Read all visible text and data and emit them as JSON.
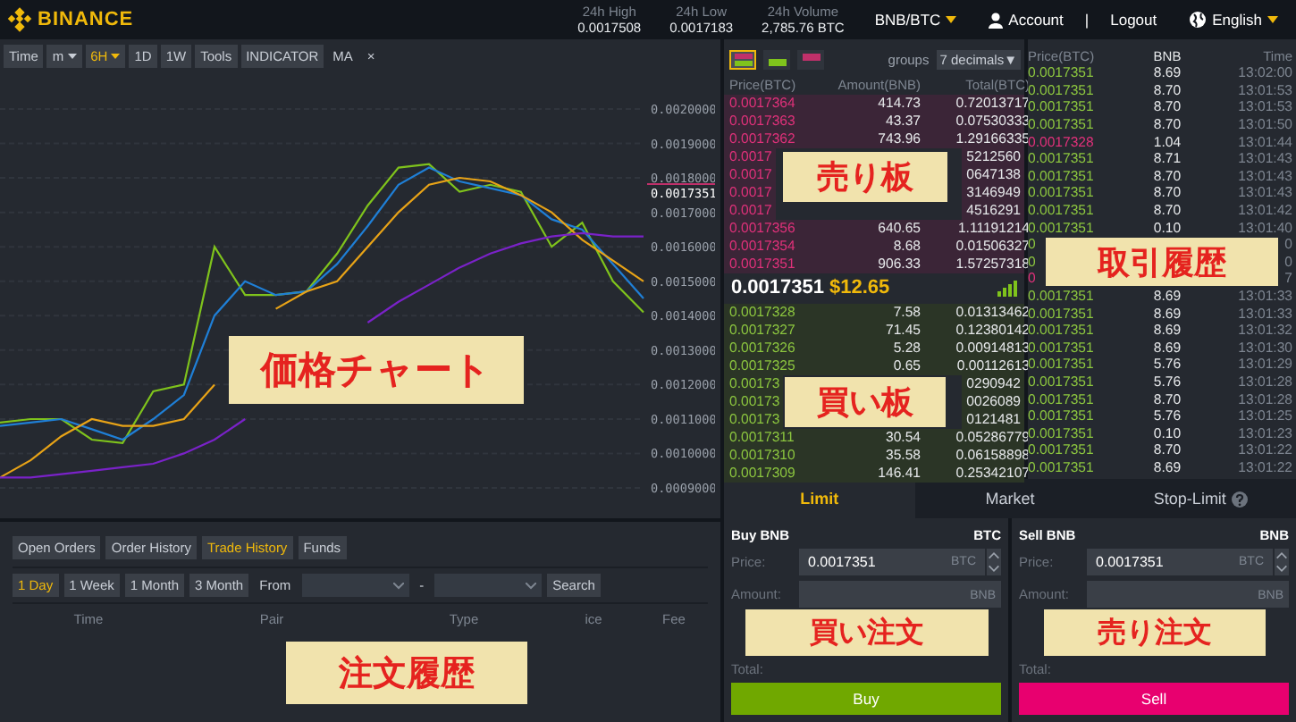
{
  "header": {
    "logo": "BINANCE",
    "stats": [
      {
        "label": "24h High",
        "value": "0.0017508"
      },
      {
        "label": "24h Low",
        "value": "0.0017183"
      },
      {
        "label": "24h Volume",
        "value": "2,785.76 BTC"
      }
    ],
    "pair": "BNB/BTC",
    "account": "Account",
    "separator": "|",
    "logout": "Logout",
    "language": "English"
  },
  "chart": {
    "toolbar": [
      {
        "label": "Time",
        "dropdown": false,
        "selected": false
      },
      {
        "label": "m",
        "dropdown": true,
        "selected": false
      },
      {
        "label": "6H",
        "dropdown": true,
        "selected": true
      },
      {
        "label": "1D",
        "dropdown": false,
        "selected": false
      },
      {
        "label": "1W",
        "dropdown": false,
        "selected": false
      },
      {
        "label": "Tools",
        "dropdown": false,
        "selected": false
      },
      {
        "label": "INDICATOR",
        "dropdown": false,
        "selected": false
      }
    ],
    "indicator": "MA",
    "close": "×",
    "current_price": "0.0017351",
    "annotation": "価格チャート",
    "chart_data": {
      "type": "line",
      "grid": true,
      "ylim": [
        0.0009,
        0.002
      ],
      "yticks": [
        {
          "value": 0.0009,
          "label": "0.0009000"
        },
        {
          "value": 0.001,
          "label": "0.0010000"
        },
        {
          "value": 0.0011,
          "label": "0.0011000"
        },
        {
          "value": 0.0012,
          "label": "0.0012000"
        },
        {
          "value": 0.0013,
          "label": "0.0013000"
        },
        {
          "value": 0.0014,
          "label": "0.0014000"
        },
        {
          "value": 0.0015,
          "label": "0.0015000"
        },
        {
          "value": 0.0016,
          "label": "0.0016000"
        },
        {
          "value": 0.0017,
          "label": "0.0017000"
        },
        {
          "value": 0.0018,
          "label": "0.0018000"
        },
        {
          "value": 0.0019,
          "label": "0.0019000"
        },
        {
          "value": 0.002,
          "label": "0.0020000"
        }
      ],
      "series": [
        {
          "color": "#7fc31c",
          "values": [
            0.00109,
            0.0011,
            0.0011,
            0.00104,
            0.00103,
            0.00118,
            0.0012,
            0.0016,
            0.00146,
            0.00146,
            0.00147,
            0.00158,
            0.00172,
            0.00183,
            0.00184,
            0.00176,
            0.00178,
            0.00176,
            0.0016,
            0.00167,
            0.0015,
            0.00141
          ]
        },
        {
          "color": "#1f7fd6",
          "values": [
            0.00108,
            0.00109,
            0.0011,
            0.00107,
            0.00104,
            0.0011,
            0.00117,
            0.0014,
            0.0015,
            0.00146,
            0.00147,
            0.00155,
            0.00166,
            0.00178,
            0.00183,
            0.00179,
            0.00177,
            0.00175,
            0.00168,
            0.00165,
            0.00155,
            0.00145
          ]
        },
        {
          "color": "#e8a317",
          "values": [
            0.00093,
            0.00098,
            0.00105,
            0.0011,
            0.00108,
            0.00108,
            0.0011,
            0.0012,
            null,
            0.00142,
            0.00147,
            0.0015,
            0.0016,
            0.0017,
            0.00178,
            0.0018,
            0.00179,
            0.00175,
            0.0017,
            0.00162,
            0.00156,
            0.0015
          ]
        },
        {
          "color": "#7a22c8",
          "values": [
            0.00093,
            0.00093,
            0.00094,
            0.00095,
            0.00096,
            0.00097,
            0.001,
            0.00104,
            0.0011,
            null,
            null,
            null,
            0.00138,
            0.00144,
            0.00149,
            0.00154,
            0.00158,
            0.00161,
            0.00163,
            0.00164,
            0.00163,
            0.00163
          ]
        }
      ]
    }
  },
  "order_book": {
    "views": [
      {
        "kind": "both",
        "selected": true
      },
      {
        "kind": "buy",
        "selected": false
      },
      {
        "kind": "sell",
        "selected": false
      }
    ],
    "groups_label": "groups",
    "decimals": "7 decimals▼",
    "columns": [
      "Price(BTC)",
      "Amount(BNB)",
      "Total(BTC)"
    ],
    "sell_annotation": "売り板",
    "buy_annotation": "買い板",
    "asks": [
      {
        "price": "0.0017364",
        "amount": "414.73",
        "total": "0.72013717"
      },
      {
        "price": "0.0017363",
        "amount": "43.37",
        "total": "0.07530333"
      },
      {
        "price": "0.0017362",
        "amount": "743.96",
        "total": "1.29166335"
      },
      {
        "price": "0.0017",
        "total": "5212560"
      },
      {
        "price": "0.0017",
        "total": "0647138"
      },
      {
        "price": "0.0017",
        "total": "3146949"
      },
      {
        "price": "0.0017",
        "total": "4516291"
      },
      {
        "price": "0.0017356",
        "amount": "640.65",
        "total": "1.11191214"
      },
      {
        "price": "0.0017354",
        "amount": "8.68",
        "total": "0.01506327"
      },
      {
        "price": "0.0017351",
        "amount": "906.33",
        "total": "1.57257318"
      }
    ],
    "last_price": "0.0017351",
    "last_price_usd": "$12.65",
    "bids": [
      {
        "price": "0.0017328",
        "amount": "7.58",
        "total": "0.01313462"
      },
      {
        "price": "0.0017327",
        "amount": "71.45",
        "total": "0.12380142"
      },
      {
        "price": "0.0017326",
        "amount": "5.28",
        "total": "0.00914813"
      },
      {
        "price": "0.0017325",
        "amount": "0.65",
        "total": "0.00112613"
      },
      {
        "price": "0.00173",
        "total": "0290942"
      },
      {
        "price": "0.00173",
        "total": "0026089"
      },
      {
        "price": "0.00173",
        "total": "0121481"
      },
      {
        "price": "0.0017311",
        "amount": "30.54",
        "total": "0.05286779"
      },
      {
        "price": "0.0017310",
        "amount": "35.58",
        "total": "0.06158898"
      },
      {
        "price": "0.0017309",
        "amount": "146.41",
        "total": "0.25342107"
      }
    ]
  },
  "trades": {
    "columns": [
      "Price(BTC)",
      "BNB",
      "Time"
    ],
    "annotation": "取引履歴",
    "rows": [
      {
        "kind": "buy",
        "price": "0.0017351",
        "amount": "8.69",
        "time": "13:02:00"
      },
      {
        "kind": "buy",
        "price": "0.0017351",
        "amount": "8.70",
        "time": "13:01:53"
      },
      {
        "kind": "buy",
        "price": "0.0017351",
        "amount": "8.70",
        "time": "13:01:53"
      },
      {
        "kind": "buy",
        "price": "0.0017351",
        "amount": "8.70",
        "time": "13:01:50"
      },
      {
        "kind": "sell",
        "price": "0.0017328",
        "amount": "1.04",
        "time": "13:01:44"
      },
      {
        "kind": "buy",
        "price": "0.0017351",
        "amount": "8.71",
        "time": "13:01:43"
      },
      {
        "kind": "buy",
        "price": "0.0017351",
        "amount": "8.70",
        "time": "13:01:43"
      },
      {
        "kind": "buy",
        "price": "0.0017351",
        "amount": "8.70",
        "time": "13:01:43"
      },
      {
        "kind": "buy",
        "price": "0.0017351",
        "amount": "8.70",
        "time": "13:01:42"
      },
      {
        "kind": "buy",
        "price": "0.0017351",
        "amount": "0.10",
        "time": "13:01:40"
      },
      {
        "kind": "buy",
        "price": "0",
        "time": "0"
      },
      {
        "kind": "buy",
        "price": "0",
        "time": "0"
      },
      {
        "kind": "sell",
        "price": "0",
        "time": "7"
      },
      {
        "kind": "buy",
        "price": "0.0017351",
        "amount": "8.69",
        "time": "13:01:33"
      },
      {
        "kind": "buy",
        "price": "0.0017351",
        "amount": "8.69",
        "time": "13:01:33"
      },
      {
        "kind": "buy",
        "price": "0.0017351",
        "amount": "8.69",
        "time": "13:01:32"
      },
      {
        "kind": "buy",
        "price": "0.0017351",
        "amount": "8.69",
        "time": "13:01:30"
      },
      {
        "kind": "buy",
        "price": "0.0017351",
        "amount": "5.76",
        "time": "13:01:29"
      },
      {
        "kind": "buy",
        "price": "0.0017351",
        "amount": "5.76",
        "time": "13:01:28"
      },
      {
        "kind": "buy",
        "price": "0.0017351",
        "amount": "8.70",
        "time": "13:01:28"
      },
      {
        "kind": "buy",
        "price": "0.0017351",
        "amount": "5.76",
        "time": "13:01:25"
      },
      {
        "kind": "buy",
        "price": "0.0017351",
        "amount": "0.10",
        "time": "13:01:23"
      },
      {
        "kind": "buy",
        "price": "0.0017351",
        "amount": "8.70",
        "time": "13:01:22"
      },
      {
        "kind": "buy",
        "price": "0.0017351",
        "amount": "8.69",
        "time": "13:01:22"
      }
    ]
  },
  "orders": {
    "tabs": [
      {
        "label": "Open Orders",
        "selected": false
      },
      {
        "label": "Order History",
        "selected": false
      },
      {
        "label": "Trade History",
        "selected": true
      },
      {
        "label": "Funds",
        "selected": false
      }
    ],
    "ranges": [
      {
        "label": "1 Day",
        "selected": true
      },
      {
        "label": "1 Week",
        "selected": false
      },
      {
        "label": "1 Month",
        "selected": false
      },
      {
        "label": "3 Month",
        "selected": false
      }
    ],
    "from_label": "From",
    "range_separator": "-",
    "search": "Search",
    "columns": [
      "Time",
      "Pair",
      "Type",
      "ice",
      "Fee"
    ],
    "annotation": "注文履歴"
  },
  "order_form": {
    "tabs": [
      {
        "label": "Limit",
        "selected": true,
        "help": false
      },
      {
        "label": "Market",
        "selected": false,
        "help": false
      },
      {
        "label": "Stop-Limit",
        "selected": false,
        "help": true
      }
    ],
    "sides": [
      {
        "kind": "buy",
        "title": "Buy BNB",
        "balance_unit": "BTC",
        "price_label": "Price:",
        "price": "0.0017351",
        "price_unit": "BTC",
        "amount_label": "Amount:",
        "amount_placeholder": "BNB",
        "total_label": "Total:",
        "button": "Buy",
        "annotation": "買い注文"
      },
      {
        "kind": "sell",
        "title": "Sell BNB",
        "balance_unit": "BNB",
        "price_label": "Price:",
        "price": "0.0017351",
        "price_unit": "BTC",
        "amount_label": "Amount:",
        "amount_placeholder": "BNB",
        "total_label": "Total:",
        "button": "Sell",
        "annotation": "売り注文"
      }
    ]
  }
}
